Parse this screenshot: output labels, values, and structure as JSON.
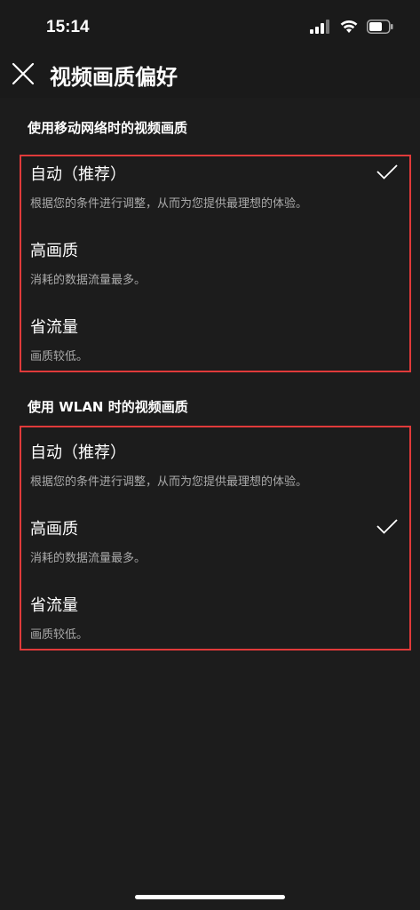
{
  "status_bar": {
    "time": "15:14",
    "icons": [
      "cellular-signal-icon",
      "wifi-icon",
      "battery-icon"
    ]
  },
  "header": {
    "title": "视频画质偏好",
    "close_icon": "close-icon"
  },
  "sections": [
    {
      "title": "使用移动网络时的视频画质",
      "options": [
        {
          "label": "自动（推荐）",
          "description": "根据您的条件进行调整，从而为您提供最理想的体验。",
          "selected": true
        },
        {
          "label": "高画质",
          "description": "消耗的数据流量最多。",
          "selected": false
        },
        {
          "label": "省流量",
          "description": "画质较低。",
          "selected": false
        }
      ]
    },
    {
      "title": "使用 WLAN 时的视频画质",
      "options": [
        {
          "label": "自动（推荐）",
          "description": "根据您的条件进行调整，从而为您提供最理想的体验。",
          "selected": false
        },
        {
          "label": "高画质",
          "description": "消耗的数据流量最多。",
          "selected": true
        },
        {
          "label": "省流量",
          "description": "画质较低。",
          "selected": false
        }
      ]
    }
  ],
  "colors": {
    "background": "#1c1c1c",
    "highlight_border": "#e03a3a",
    "description_text": "#aaaaaa"
  }
}
